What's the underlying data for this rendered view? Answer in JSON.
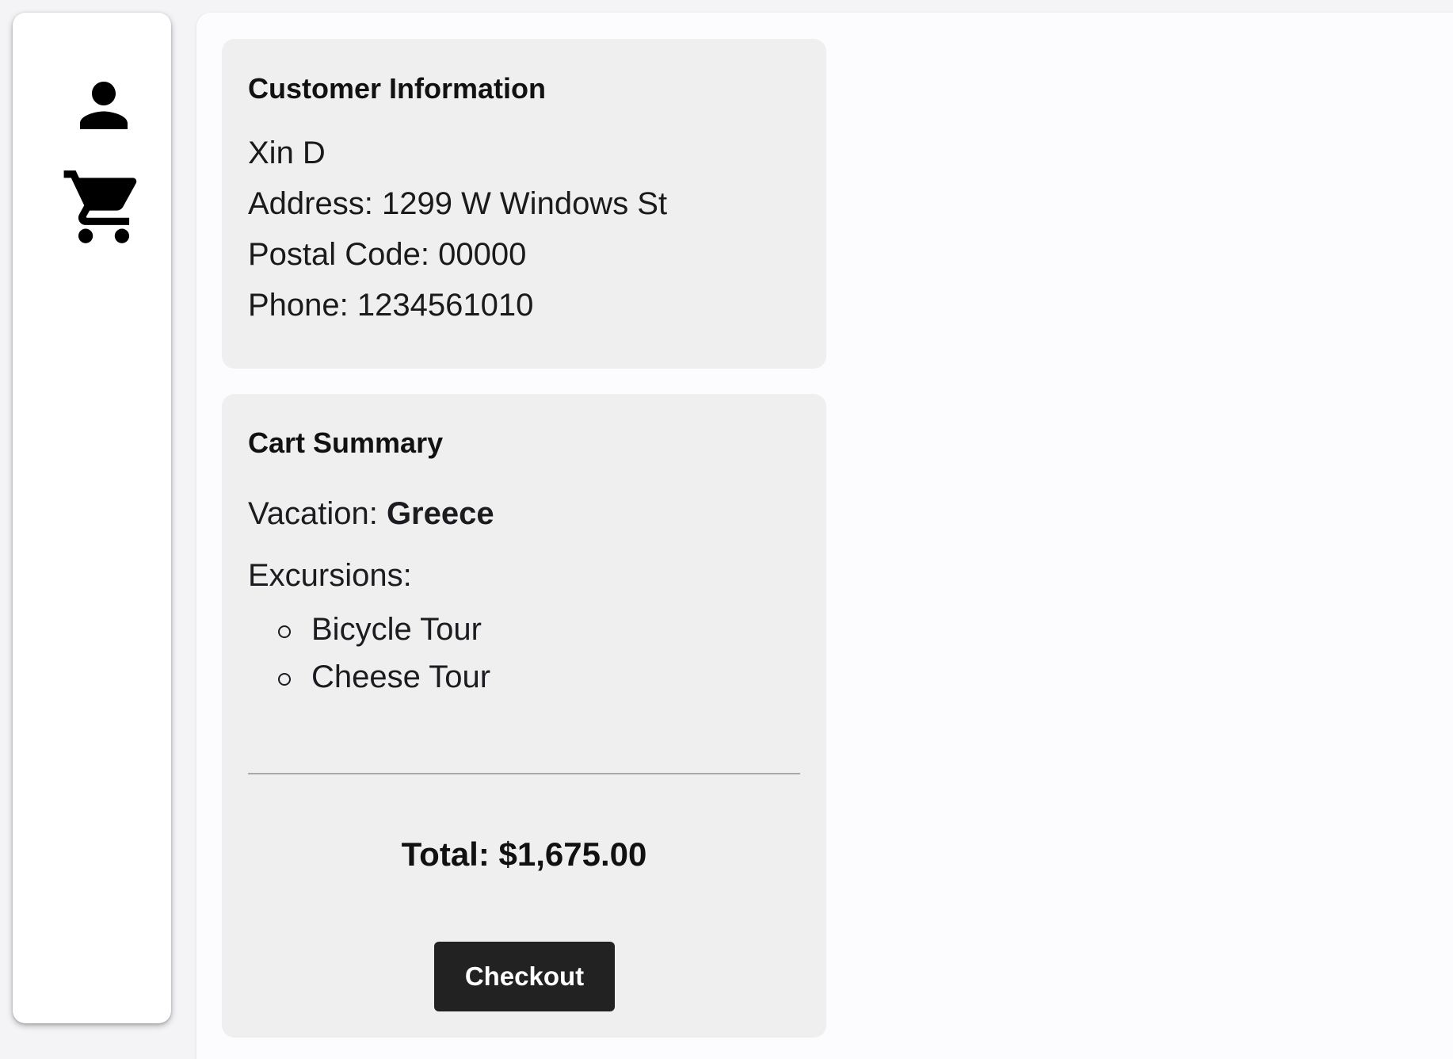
{
  "nav": {
    "items": [
      {
        "icon": "person-icon"
      },
      {
        "icon": "shopping-cart-icon"
      }
    ]
  },
  "customer_card": {
    "title": "Customer Information",
    "name": "Xin D",
    "address": "Address: 1299 W Windows St",
    "postal_code": "Postal Code: 00000",
    "phone": "Phone: 1234561010"
  },
  "cart_card": {
    "title": "Cart Summary",
    "vacation_label": "Vacation:",
    "vacation_name": "Greece",
    "excursions_label": "Excursions:",
    "excursions": [
      "Bicycle Tour",
      "Cheese Tour"
    ],
    "total": "Total: $1,675.00",
    "checkout_label": "Checkout"
  },
  "colors": {
    "page_background": "#f4f3f6",
    "card_background": "#efefef",
    "button_background": "#222222",
    "button_text": "#ffffff"
  }
}
